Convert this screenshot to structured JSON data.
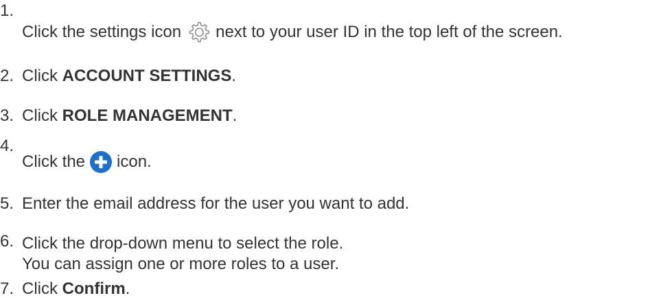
{
  "steps": [
    {
      "num": "1.",
      "before": "Click the settings icon",
      "after": "next to your user ID in the top left of the screen.",
      "icon": "gear-icon"
    },
    {
      "num": "2.",
      "before": "Click ",
      "bold": "ACCOUNT SETTINGS",
      "after": "."
    },
    {
      "num": "3.",
      "before": "Click ",
      "bold": "ROLE MANAGEMENT",
      "after": "."
    },
    {
      "num": "4.",
      "before": "Click the",
      "after": "icon.",
      "icon": "plus-circle-icon",
      "icon_color": "#1e6fc9"
    },
    {
      "num": "5.",
      "text": "Enter the email address for the user you want to add."
    },
    {
      "num": "6.",
      "text": "Click the drop-down menu to select the role.",
      "text2": "You can assign one or more roles to a user."
    },
    {
      "num": "7.",
      "before": "Click ",
      "bold": "Confirm",
      "after": "."
    }
  ]
}
